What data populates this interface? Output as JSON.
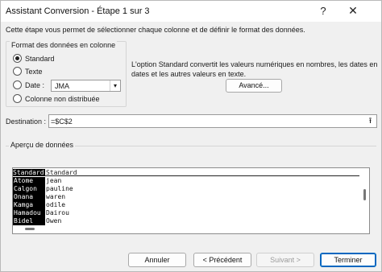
{
  "window": {
    "title": "Assistant Conversion - Étape 1 sur 3",
    "help_glyph": "?",
    "close_glyph": "✕"
  },
  "intro": "Cette étape vous permet de sélectionner chaque colonne et de définir le format des données.",
  "format_group": {
    "title": "Format des données en colonne",
    "options": [
      {
        "label": "Standard",
        "checked": true
      },
      {
        "label": "Texte",
        "checked": false
      },
      {
        "label": "Date :",
        "checked": false
      },
      {
        "label": "Colonne non distribuée",
        "checked": false
      }
    ],
    "date_value": "JMA"
  },
  "info_text": "L'option Standard convertit les valeurs numériques en nombres, les dates en dates et les autres valeurs en texte.",
  "advanced_button": "Avancé...",
  "destination": {
    "label": "Destination :",
    "value": "=$C$2"
  },
  "preview": {
    "title": "Aperçu de données",
    "headers": [
      "Standard",
      "Standard"
    ],
    "rows": [
      [
        "Atome",
        "jean"
      ],
      [
        "Calgon",
        "pauline"
      ],
      [
        "Onana",
        "waren"
      ],
      [
        "Kamga",
        "odile"
      ],
      [
        "Hamadou",
        "Dairou"
      ],
      [
        "Bidel",
        "Owen"
      ]
    ]
  },
  "buttons": {
    "cancel": "Annuler",
    "previous": "< Précédent",
    "next": "Suivant >",
    "finish": "Terminer"
  },
  "icons": {
    "help": "help-icon",
    "close": "close-icon",
    "dropdown": "chevron-down-icon",
    "collapse": "collapse-dialog-icon"
  }
}
